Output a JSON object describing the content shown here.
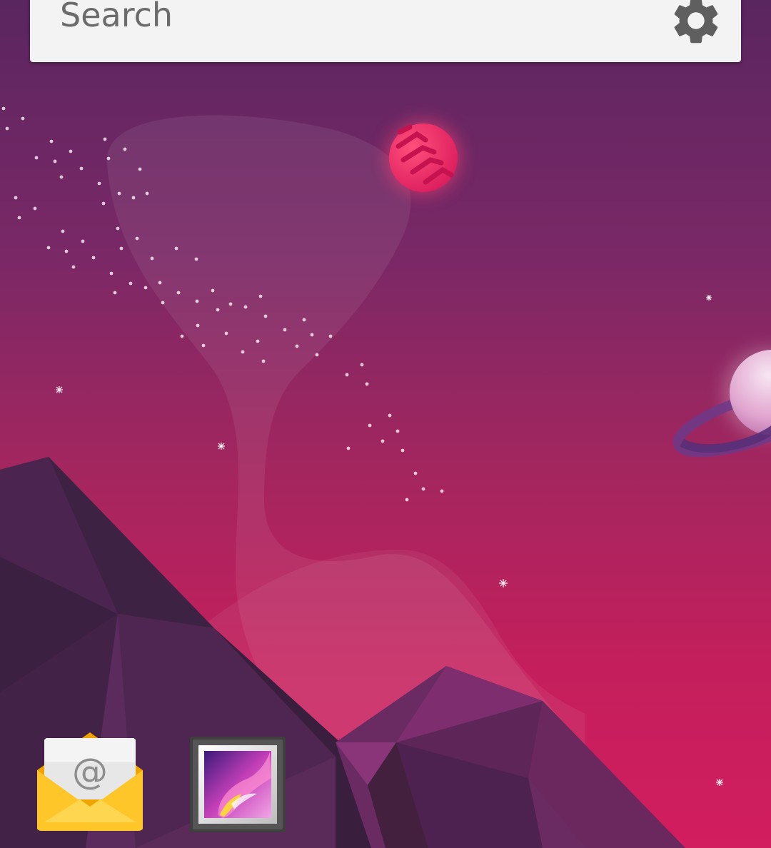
{
  "search": {
    "placeholder": "Search",
    "settings_icon": "gear-icon"
  },
  "dock": {
    "apps": [
      {
        "id": "email",
        "icon": "email-envelope-icon"
      },
      {
        "id": "gallery",
        "icon": "gallery-picture-icon"
      }
    ]
  },
  "theme": {
    "search_bar_bg": "#f3f3f3",
    "search_text_color": "#6b6b6b",
    "wallpaper_top": "#5a2660",
    "wallpaper_bottom": "#d21d5e",
    "planet_color": "#e8245e"
  }
}
